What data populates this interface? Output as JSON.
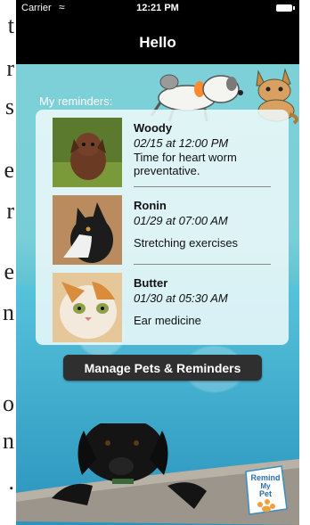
{
  "status_bar": {
    "carrier": "Carrier",
    "time": "12:21 PM"
  },
  "nav": {
    "title": "Hello"
  },
  "reminders_label": "My reminders:",
  "reminders": [
    {
      "pet": "Woody",
      "when": "02/15 at 12:00 PM",
      "note": "Time for heart worm preventative."
    },
    {
      "pet": "Ronin",
      "when": "01/29 at 07:00 AM",
      "note": "Stretching exercises"
    },
    {
      "pet": "Butter",
      "when": "01/30 at 05:30 AM",
      "note": "Ear medicine"
    }
  ],
  "manage_button_label": "Manage Pets & Reminders",
  "logo": {
    "line1": "Remind",
    "line2": "My",
    "line3": "Pet"
  },
  "colors": {
    "nav_bg": "#000000",
    "panel_bg": "#ecf8f9",
    "button_bg": "#2f2f2f",
    "accent": "#f0a03c"
  },
  "side_fragments": {
    "left": [
      "t",
      "r",
      "s",
      "e",
      "r",
      "e",
      "n",
      "o",
      "n",
      "."
    ]
  }
}
